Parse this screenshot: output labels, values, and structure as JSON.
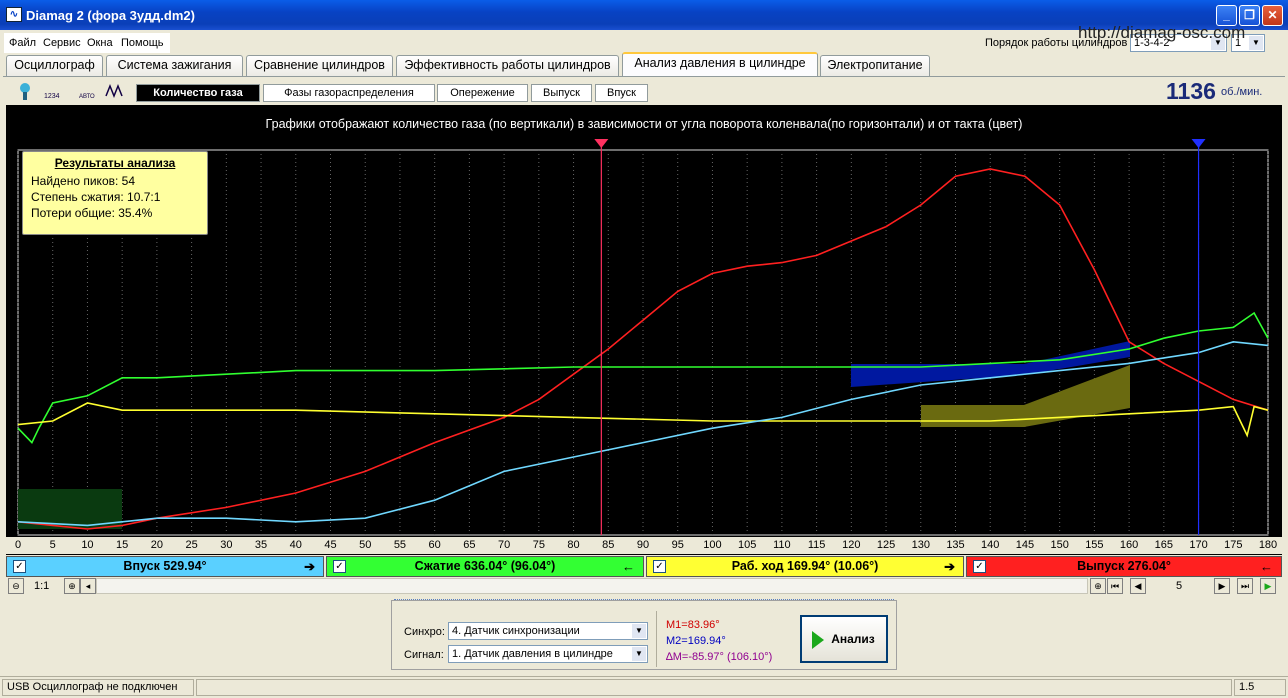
{
  "window": {
    "title": "Diamag 2 (фора 3удд.dm2)",
    "url": "http://diamag-osc.com"
  },
  "menu": [
    "Файл",
    "Сервис",
    "Окна",
    "Помощь"
  ],
  "header": {
    "order_label": "Порядок работы цилиндров",
    "order_value": "1-3-4-2",
    "cyl_value": "1"
  },
  "tabs": [
    "Осциллограф",
    "Система зажигания",
    "Сравнение цилиндров",
    "Эффективность работы цилиндров",
    "Анализ давления в цилиндре",
    "Электропитание"
  ],
  "active_tab": 4,
  "toolbar": {
    "t1": "",
    "t2": "1234",
    "t3": "АВТО",
    "t4": ""
  },
  "subtabs": [
    "Количество газа",
    "Фазы газораспределения",
    "Опережение",
    "Выпуск",
    "Впуск"
  ],
  "rpm": {
    "value": "1136",
    "unit": "об./мин."
  },
  "chart": {
    "title": "Графики отображают количество газа (по вертикали) в зависимости от угла поворота коленвала(по горизонтали) и от такта (цвет)"
  },
  "results": {
    "heading": "Результаты анализа",
    "line1": "Найдено пиков: 54",
    "line2": "Степень сжатия: 10.7:1",
    "line3": "Потери общие: 35.4%"
  },
  "chart_data": {
    "type": "line",
    "xlim": [
      0,
      180
    ],
    "x_ticks": [
      0,
      5,
      10,
      15,
      20,
      25,
      30,
      35,
      40,
      45,
      50,
      55,
      60,
      65,
      70,
      75,
      80,
      85,
      90,
      95,
      100,
      105,
      110,
      115,
      120,
      125,
      130,
      135,
      140,
      145,
      150,
      155,
      160,
      165,
      170,
      175,
      180
    ],
    "ylim": [
      0,
      100
    ],
    "grid": true,
    "markers": [
      {
        "x": 84,
        "color": "#ff3060"
      },
      {
        "x": 170,
        "color": "#2030ff"
      }
    ],
    "series": [
      {
        "color": "#ff2020",
        "x": [
          0,
          5,
          10,
          15,
          20,
          30,
          40,
          50,
          60,
          70,
          75,
          80,
          85,
          90,
          95,
          100,
          105,
          110,
          115,
          120,
          125,
          130,
          135,
          140,
          145,
          150,
          155,
          160,
          165,
          170,
          175,
          180
        ],
        "y": [
          2,
          1,
          0,
          1,
          3,
          6,
          10,
          16,
          24,
          31,
          36,
          43,
          50,
          58,
          66,
          71,
          73,
          74,
          76,
          80,
          84,
          90,
          98,
          100,
          98,
          90,
          72,
          52,
          46,
          41,
          36,
          33
        ]
      },
      {
        "color": "#30ff30",
        "x": [
          0,
          2,
          3,
          5,
          10,
          15,
          20,
          40,
          60,
          80,
          100,
          120,
          130,
          140,
          150,
          160,
          165,
          170,
          175,
          178,
          180
        ],
        "y": [
          28,
          24,
          28,
          35,
          37,
          42,
          42,
          44,
          44,
          45,
          45,
          45,
          45,
          46,
          47,
          50,
          53,
          55,
          56,
          60,
          53
        ]
      },
      {
        "color": "#ffff30",
        "x": [
          0,
          5,
          10,
          15,
          20,
          40,
          60,
          80,
          100,
          120,
          140,
          160,
          170,
          175,
          177,
          178,
          180
        ],
        "y": [
          29,
          30,
          35,
          33,
          33,
          33,
          32,
          31,
          30,
          30,
          30,
          32,
          33,
          34,
          26,
          34,
          33
        ]
      },
      {
        "color": "#70d8ff",
        "x": [
          0,
          10,
          20,
          30,
          40,
          50,
          60,
          70,
          80,
          90,
          100,
          110,
          120,
          130,
          140,
          150,
          160,
          170,
          175,
          180
        ],
        "y": [
          2,
          1,
          3,
          3,
          2,
          3,
          8,
          16,
          20,
          24,
          28,
          31,
          36,
          40,
          42,
          44,
          46,
          49,
          52,
          51
        ]
      }
    ]
  },
  "phases": [
    {
      "label": "Впуск 529.94°",
      "color": "#5ad0ff",
      "arrow": "➔"
    },
    {
      "label": "Сжатие 636.04° (96.04°)",
      "color": "#33ff33",
      "arrow": "🡐"
    },
    {
      "label": "Раб. ход 169.94° (10.06°)",
      "color": "#ffff33",
      "arrow": "➔"
    },
    {
      "label": "Выпуск 276.04°",
      "color": "#ff2020",
      "arrow": "🡐"
    }
  ],
  "zoom": {
    "label": "1:1",
    "page": "5"
  },
  "panel": {
    "sync_label": "Синхро:",
    "sync_value": "4.  Датчик синхронизации",
    "signal_label": "Сигнал:",
    "signal_value": "1.  Датчик давления в цилиндре",
    "m1": "M1=83.96°",
    "m2": "M2=169.94°",
    "dm": "∆M=-85.97° (106.10°)",
    "analyze": "Анализ"
  },
  "status": {
    "left": "USB Осциллограф не подключен",
    "right": "1.5"
  }
}
